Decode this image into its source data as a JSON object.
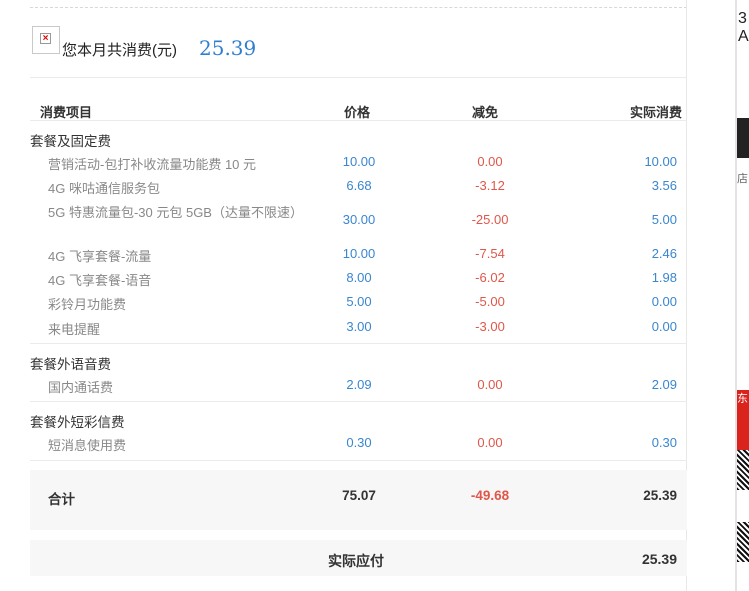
{
  "header": {
    "label": "您本月共消费(元)",
    "amount": "25.39",
    "image_icon": "broken-image-icon"
  },
  "columns": {
    "item": "消费项目",
    "price": "价格",
    "discount": "减免",
    "actual": "实际消费"
  },
  "groups": [
    {
      "title": "套餐及固定费",
      "rows": [
        {
          "name": "营销活动-包打补收流量功能费 10 元",
          "price": "10.00",
          "discount": "0.00",
          "actual": "10.00"
        },
        {
          "name": "4G 咪咕通信服务包",
          "price": "6.68",
          "discount": "-3.12",
          "actual": "3.56"
        },
        {
          "name": "5G 特惠流量包-30 元包 5GB（达量不限速）",
          "price": "30.00",
          "discount": "-25.00",
          "actual": "5.00"
        },
        {
          "name": "4G 飞享套餐-流量",
          "price": "10.00",
          "discount": "-7.54",
          "actual": "2.46"
        },
        {
          "name": "4G 飞享套餐-语音",
          "price": "8.00",
          "discount": "-6.02",
          "actual": "1.98"
        },
        {
          "name": "彩铃月功能费",
          "price": "5.00",
          "discount": "-5.00",
          "actual": "0.00"
        },
        {
          "name": "来电提醒",
          "price": "3.00",
          "discount": "-3.00",
          "actual": "0.00"
        }
      ]
    },
    {
      "title": "套餐外语音费",
      "rows": [
        {
          "name": "国内通话费",
          "price": "2.09",
          "discount": "0.00",
          "actual": "2.09"
        }
      ]
    },
    {
      "title": "套餐外短彩信费",
      "rows": [
        {
          "name": "短消息使用费",
          "price": "0.30",
          "discount": "0.00",
          "actual": "0.30"
        }
      ]
    }
  ],
  "total": {
    "label": "合计",
    "price": "75.07",
    "discount": "-49.68",
    "actual": "25.39"
  },
  "payable": {
    "label": "实际应付",
    "amount": "25.39"
  },
  "right_panel": {
    "top_char1": "3",
    "top_char2": "A",
    "small_text": "店",
    "red_text": "东"
  },
  "colors": {
    "accent_blue": "#2f7fd0",
    "discount_red": "#e0574a",
    "band_gray": "#f7f7f7"
  }
}
